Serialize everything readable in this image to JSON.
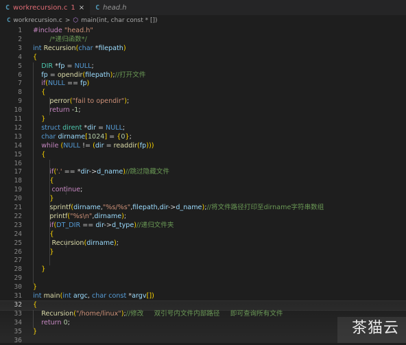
{
  "tabs": [
    {
      "lang": "C",
      "name": "workrecursion.c",
      "errors": "1",
      "close": "×",
      "active": true
    },
    {
      "lang": "C",
      "name": "head.h",
      "active": false
    }
  ],
  "breadcrumb": {
    "lang": "C",
    "file": "workrecursion.c",
    "sep1": ">",
    "symbol_icon": "cube-icon",
    "symbol": "main(int, char const * [])"
  },
  "code_lines": [
    {
      "n": "1",
      "text": "#include \"head.h\""
    },
    {
      "n": "2",
      "text": "        /*递归函数*/"
    },
    {
      "n": "3",
      "text": "int Recursion(char *filepath)"
    },
    {
      "n": "4",
      "text": "{"
    },
    {
      "n": "5",
      "text": "    DIR *fp = NULL;"
    },
    {
      "n": "6",
      "text": "    fp = opendir(filepath);//打开文件"
    },
    {
      "n": "7",
      "text": "    if(NULL == fp)"
    },
    {
      "n": "8",
      "text": "    {"
    },
    {
      "n": "9",
      "text": "        perror(\"fail to opendir\");"
    },
    {
      "n": "10",
      "text": "        return -1;"
    },
    {
      "n": "11",
      "text": "    }"
    },
    {
      "n": "12",
      "text": "    struct dirent *dir = NULL;"
    },
    {
      "n": "13",
      "text": "    char dirname[1024] = {0};"
    },
    {
      "n": "14",
      "text": "    while (NULL != (dir = readdir(fp)))"
    },
    {
      "n": "15",
      "text": "    {"
    },
    {
      "n": "16",
      "text": ""
    },
    {
      "n": "17",
      "text": "        if('.' == *dir->d_name)//跳过隐藏文件"
    },
    {
      "n": "18",
      "text": "        {"
    },
    {
      "n": "19",
      "text": "         continue;"
    },
    {
      "n": "20",
      "text": "        }"
    },
    {
      "n": "21",
      "text": "        sprintf(dirname,\"%s/%s\",filepath,dir->d_name);//将文件路径打印至dirname字符串数组"
    },
    {
      "n": "22",
      "text": "        printf(\"%s\\n\",dirname);"
    },
    {
      "n": "23",
      "text": "        if(DT_DIR == dir->d_type)//递归文件夹"
    },
    {
      "n": "24",
      "text": "        {"
    },
    {
      "n": "25",
      "text": "         Recursion(dirname);"
    },
    {
      "n": "26",
      "text": "        }"
    },
    {
      "n": "27",
      "text": ""
    },
    {
      "n": "28",
      "text": "    }"
    },
    {
      "n": "29",
      "text": ""
    },
    {
      "n": "30",
      "text": "}"
    },
    {
      "n": "31",
      "text": "int main(int argc, char const *argv[])"
    },
    {
      "n": "32",
      "text": "{"
    },
    {
      "n": "33",
      "text": "    Recursion(\"/home/linux\");//修改     双引号内文件内部路径     即可查询所有文件"
    },
    {
      "n": "34",
      "text": "    return 0;"
    },
    {
      "n": "35",
      "text": "}"
    },
    {
      "n": "36",
      "text": ""
    }
  ],
  "current_line": "32",
  "watermark": "茶猫云",
  "colors": {
    "background": "#1e1e1e",
    "keyword": "#569cd6",
    "function": "#dcdcaa",
    "type": "#4ec9b0",
    "variable": "#9cdcfe",
    "string": "#ce9178",
    "number": "#b5cea8",
    "comment": "#6a9955",
    "control": "#c586c0",
    "error": "#e06c75"
  }
}
